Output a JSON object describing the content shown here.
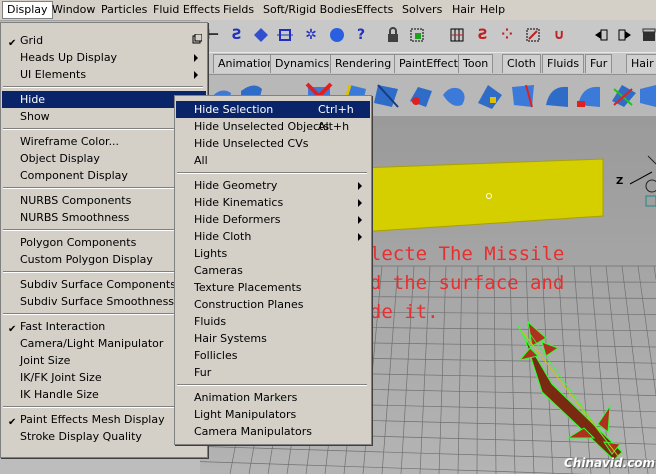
{
  "menubar": [
    "Display",
    "Window",
    "Particles",
    "Fluid Effects",
    "Fields",
    "Soft/Rigid Bodies",
    "Effects",
    "Solvers",
    "Hair",
    "Help"
  ],
  "shelf_tabs": [
    "Animation",
    "Dynamics",
    "Rendering",
    "PaintEffects",
    "Toon",
    "Cloth",
    "Fluids",
    "Fur",
    "Hair"
  ],
  "display_menu": {
    "items": [
      {
        "label": "Grid",
        "checked": true,
        "option_box": true
      },
      {
        "label": "Heads Up Display",
        "submenu": true
      },
      {
        "label": "UI Elements",
        "submenu": true
      },
      {
        "label": "Hide",
        "submenu": true,
        "highlighted": true
      },
      {
        "label": "Show",
        "submenu": true
      },
      {
        "label": "Wireframe Color..."
      },
      {
        "label": "Object Display",
        "submenu": true
      },
      {
        "label": "Component Display",
        "submenu": true
      },
      {
        "label": "NURBS Components",
        "submenu": true
      },
      {
        "label": "NURBS Smoothness",
        "submenu": true
      },
      {
        "label": "Polygon Components",
        "submenu": true
      },
      {
        "label": "Custom Polygon Display"
      },
      {
        "label": "Subdiv Surface Components",
        "submenu": true
      },
      {
        "label": "Subdiv Surface Smoothness",
        "submenu": true
      },
      {
        "label": "Fast Interaction",
        "checked": true
      },
      {
        "label": "Camera/Light Manipulator",
        "submenu": true
      },
      {
        "label": "Joint Size",
        "submenu": true
      },
      {
        "label": "IK/FK Joint Size",
        "submenu": true
      },
      {
        "label": "IK Handle Size",
        "submenu": true
      },
      {
        "label": "Paint Effects Mesh Display",
        "checked": true
      },
      {
        "label": "Stroke Display Quality",
        "submenu": true
      }
    ]
  },
  "hide_menu": {
    "items": [
      {
        "label": "Hide Selection",
        "shortcut": "Ctrl+h",
        "highlighted": true
      },
      {
        "label": "Hide Unselected Objects",
        "shortcut": "Alt+h"
      },
      {
        "label": "Hide Unselected CVs"
      },
      {
        "label": "All"
      },
      {
        "label": "Hide Geometry",
        "submenu": true
      },
      {
        "label": "Hide Kinematics",
        "submenu": true
      },
      {
        "label": "Hide Deformers",
        "submenu": true
      },
      {
        "label": "Hide Cloth",
        "submenu": true
      },
      {
        "label": "Lights"
      },
      {
        "label": "Cameras"
      },
      {
        "label": "Texture Placements"
      },
      {
        "label": "Construction Planes"
      },
      {
        "label": "Fluids"
      },
      {
        "label": "Hair Systems"
      },
      {
        "label": "Follicles"
      },
      {
        "label": "Fur"
      },
      {
        "label": "Animation Markers"
      },
      {
        "label": "Light Manipulators"
      },
      {
        "label": "Camera Manipulators"
      }
    ]
  },
  "annotation": {
    "line1": "Selecte The Missile",
    "line2": "And the surface and",
    "line3": "Hide it."
  },
  "viewport": {
    "axis_label": "Z"
  },
  "watermark": "Chinavid.com",
  "colors": {
    "menu_bg": "#d4d0c8",
    "highlight": "#0a246a",
    "plane": "#d8d000",
    "annotation": "#e53030",
    "missile_wire": "#30ff30"
  }
}
